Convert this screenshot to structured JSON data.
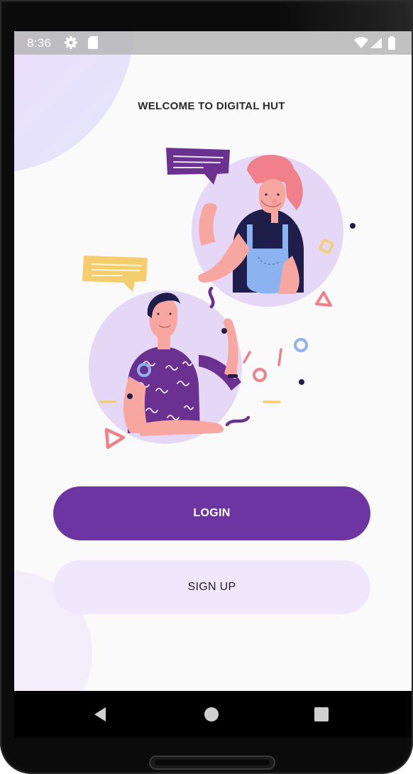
{
  "status_bar": {
    "time": "8:36",
    "icons": [
      "gear-icon",
      "sd-card-icon",
      "wifi-icon",
      "cell-signal-icon",
      "battery-icon"
    ]
  },
  "welcome": {
    "title": "WELCOME TO DIGITAL HUT"
  },
  "buttons": {
    "login": "LOGIN",
    "signup": "SIGN UP"
  },
  "navigation": {
    "icons": [
      "back-icon",
      "home-icon",
      "recents-icon"
    ]
  },
  "colors": {
    "primary": "#6d35a2",
    "secondary": "#f1e7fd",
    "background": "#fafafa"
  }
}
